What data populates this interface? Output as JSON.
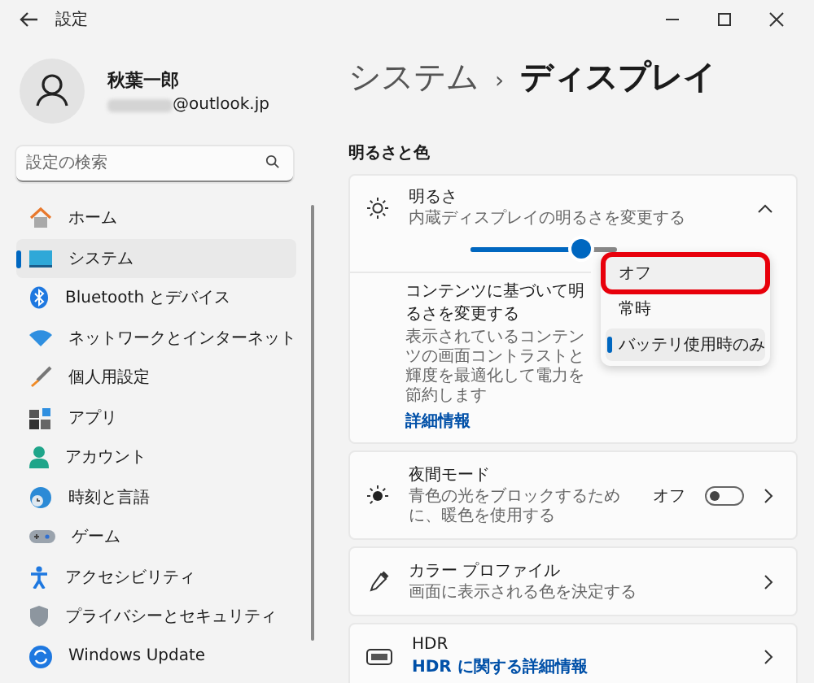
{
  "window": {
    "title": "設定"
  },
  "user": {
    "name": "秋葉一郎",
    "email": "@outlook.jp"
  },
  "search": {
    "placeholder": "設定の検索"
  },
  "sidebar": {
    "items": [
      {
        "label": "ホーム",
        "kind": "home",
        "selected": false
      },
      {
        "label": "システム",
        "kind": "system",
        "selected": true
      },
      {
        "label": "Bluetooth とデバイス",
        "kind": "bluetooth",
        "selected": false
      },
      {
        "label": "ネットワークとインターネット",
        "kind": "network",
        "selected": false
      },
      {
        "label": "個人用設定",
        "kind": "brush",
        "selected": false
      },
      {
        "label": "アプリ",
        "kind": "apps",
        "selected": false
      },
      {
        "label": "アカウント",
        "kind": "account",
        "selected": false
      },
      {
        "label": "時刻と言語",
        "kind": "time",
        "selected": false
      },
      {
        "label": "ゲーム",
        "kind": "game",
        "selected": false
      },
      {
        "label": "アクセシビリティ",
        "kind": "access",
        "selected": false
      },
      {
        "label": "プライバシーとセキュリティ",
        "kind": "shield",
        "selected": false
      },
      {
        "label": "Windows Update",
        "kind": "update",
        "selected": false
      }
    ]
  },
  "breadcrumb": {
    "parent": "システム",
    "separator": "›",
    "current": "ディスプレイ"
  },
  "section": "明るさと色",
  "brightness": {
    "title": "明るさ",
    "description": "内蔵ディスプレイの明るさを変更する",
    "level": 0.75,
    "expanded": true,
    "adaptive": {
      "title": "コンテンツに基づいて明るさを変更する",
      "description": "表示されているコンテンツの画面コントラストと輝度を最適化して電力を節約します",
      "link": "詳細情報"
    },
    "options": [
      {
        "label": "オフ",
        "selected": false,
        "highlighted": true
      },
      {
        "label": "常時",
        "selected": false,
        "highlighted": false
      },
      {
        "label": "バッテリ使用時のみ",
        "selected": true,
        "highlighted": false
      }
    ]
  },
  "cards": [
    {
      "kind": "toggle",
      "title": "夜間モード",
      "description": "青色の光をブロックするために、暖色を使用する",
      "state_label": "オフ",
      "on": false
    },
    {
      "kind": "plain",
      "title": "カラー プロファイル",
      "description": "画面に表示される色を決定する"
    },
    {
      "kind": "link",
      "title": "HDR",
      "link": "HDR に関する詳細情報"
    }
  ]
}
